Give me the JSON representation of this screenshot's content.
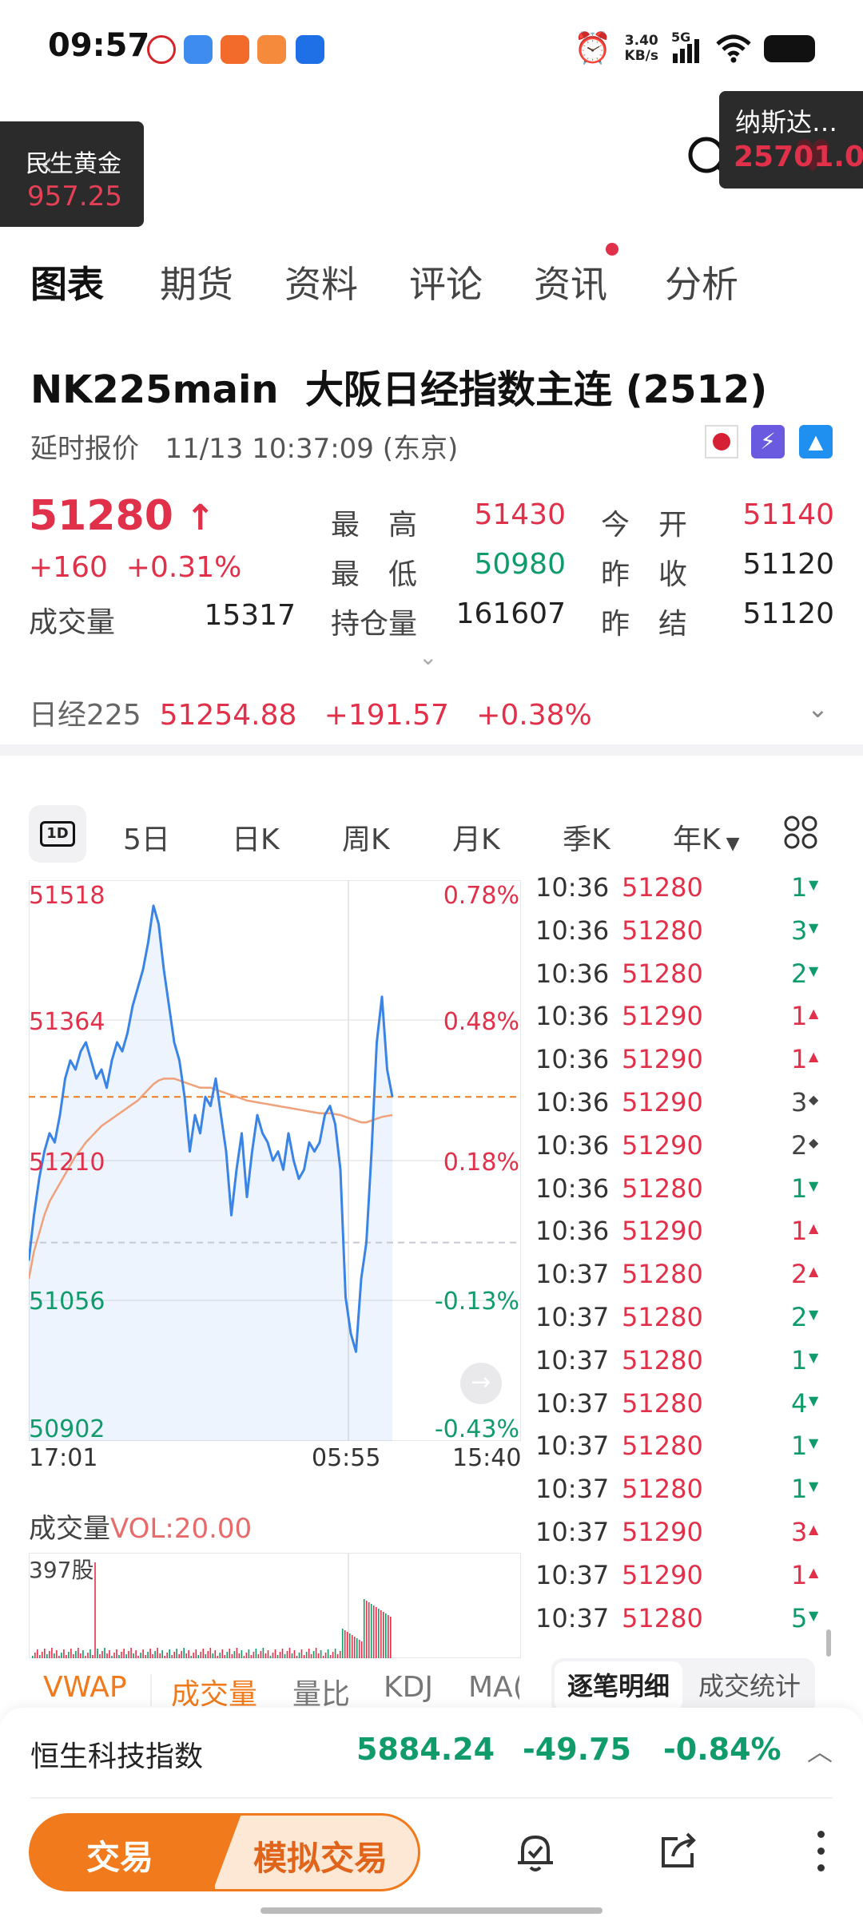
{
  "status": {
    "time": "09:57",
    "speed_top": "3.40",
    "speed_bottom": "KB/s",
    "network": "5G"
  },
  "float_left": {
    "name": "民生黄金",
    "value": "957.25"
  },
  "float_right": {
    "name": "纳斯达…",
    "value": "25701.0"
  },
  "tabs": [
    "图表",
    "期货",
    "资料",
    "评论",
    "资讯",
    "分析"
  ],
  "header": {
    "symbol": "NK225main",
    "name": "大阪日经指数主连 (2512)",
    "delay_label": "延时报价",
    "datetime": "11/13 10:37:09 (东京)"
  },
  "quote": {
    "price": "51280",
    "change": "+160",
    "change_pct": "+0.31%",
    "volume_label": "成交量",
    "volume": "15317",
    "high_label": "最　高",
    "high": "51430",
    "low_label": "最　低",
    "low": "50980",
    "oi_label": "持仓量",
    "oi": "161607",
    "open_label": "今　开",
    "open": "51140",
    "prev_close_label": "昨　收",
    "prev_close": "51120",
    "prev_settle_label": "昨　结",
    "prev_settle": "51120"
  },
  "index_line": {
    "name": "日经225",
    "value": "51254.88",
    "change": "+191.57",
    "pct": "+0.38%"
  },
  "chart_tabs": {
    "d1": "1D",
    "items": [
      "5日",
      "日K",
      "周K",
      "月K",
      "季K",
      "年K"
    ]
  },
  "chart_data": {
    "type": "line",
    "y_price_labels": [
      "51518",
      "51364",
      "51210",
      "51056",
      "50902"
    ],
    "y_pct_labels": [
      "0.78%",
      "0.48%",
      "0.18%",
      "-0.13%",
      "-0.43%"
    ],
    "x_labels": [
      "17:01",
      "05:55",
      "15:40"
    ],
    "ylim": [
      50902,
      51518
    ],
    "prev_close": 51120,
    "last": 51280,
    "series": [
      {
        "values": [
          51100,
          51150,
          51190,
          51220,
          51240,
          51230,
          51260,
          51300,
          51320,
          51310,
          51330,
          51340,
          51320,
          51300,
          51310,
          51290,
          51320,
          51340,
          51330,
          51350,
          51380,
          51400,
          51420,
          51450,
          51490,
          51470,
          51420,
          51380,
          51340,
          51320,
          51280,
          51220,
          51260,
          51240,
          51280,
          51270,
          51300,
          51260,
          51220,
          51150,
          51200,
          51240,
          51170,
          51220,
          51260,
          51240,
          51230,
          51210,
          51220,
          51200,
          51240,
          51210,
          51190,
          51200,
          51230,
          51220,
          51230,
          51260,
          51270,
          51250,
          51200,
          51060,
          51020,
          51000,
          51080,
          51120,
          51220,
          51340,
          51390,
          51310,
          51280
        ]
      },
      {
        "values": [
          51080,
          51110,
          51130,
          51150,
          51165,
          51175,
          51185,
          51195,
          51205,
          51215,
          51222,
          51230,
          51236,
          51242,
          51248,
          51252,
          51256,
          51260,
          51264,
          51268,
          51272,
          51276,
          51282,
          51288,
          51294,
          51298,
          51300,
          51300,
          51300,
          51298,
          51296,
          51294,
          51292,
          51290,
          51290,
          51290,
          51288,
          51286,
          51284,
          51282,
          51280,
          51278,
          51276,
          51275,
          51274,
          51273,
          51272,
          51271,
          51270,
          51269,
          51268,
          51267,
          51266,
          51265,
          51264,
          51263,
          51262,
          51262,
          51262,
          51261,
          51260,
          51258,
          51256,
          51254,
          51252,
          51252,
          51254,
          51256,
          51258,
          51259,
          51260
        ]
      }
    ]
  },
  "volume": {
    "label": "成交量",
    "vol": "VOL:20.00",
    "max": "397股"
  },
  "ticks": [
    {
      "t": "10:36",
      "p": "51280",
      "q": "1",
      "dir": "down"
    },
    {
      "t": "10:36",
      "p": "51280",
      "q": "3",
      "dir": "down"
    },
    {
      "t": "10:36",
      "p": "51280",
      "q": "2",
      "dir": "down"
    },
    {
      "t": "10:36",
      "p": "51290",
      "q": "1",
      "dir": "up"
    },
    {
      "t": "10:36",
      "p": "51290",
      "q": "1",
      "dir": "up"
    },
    {
      "t": "10:36",
      "p": "51290",
      "q": "3",
      "dir": "flat"
    },
    {
      "t": "10:36",
      "p": "51290",
      "q": "2",
      "dir": "flat"
    },
    {
      "t": "10:36",
      "p": "51280",
      "q": "1",
      "dir": "down"
    },
    {
      "t": "10:36",
      "p": "51290",
      "q": "1",
      "dir": "up"
    },
    {
      "t": "10:37",
      "p": "51280",
      "q": "2",
      "dir": "up"
    },
    {
      "t": "10:37",
      "p": "51280",
      "q": "2",
      "dir": "down"
    },
    {
      "t": "10:37",
      "p": "51280",
      "q": "1",
      "dir": "down"
    },
    {
      "t": "10:37",
      "p": "51280",
      "q": "4",
      "dir": "down"
    },
    {
      "t": "10:37",
      "p": "51280",
      "q": "1",
      "dir": "down"
    },
    {
      "t": "10:37",
      "p": "51280",
      "q": "1",
      "dir": "down"
    },
    {
      "t": "10:37",
      "p": "51290",
      "q": "3",
      "dir": "up"
    },
    {
      "t": "10:37",
      "p": "51290",
      "q": "1",
      "dir": "up"
    },
    {
      "t": "10:37",
      "p": "51280",
      "q": "5",
      "dir": "down"
    }
  ],
  "indicator_tabs": [
    "VWAP",
    "成交量",
    "量比",
    "KDJ",
    "MA("
  ],
  "detail_tabs": [
    "逐笔明细",
    "成交统计"
  ],
  "hs_tech": {
    "name": "恒生科技指数",
    "value": "5884.24",
    "change": "-49.75",
    "pct": "-0.84%"
  },
  "actions": {
    "trade": "交易",
    "sim_trade": "模拟交易"
  },
  "colors": {
    "up": "#e0304a",
    "down": "#0f9b6a",
    "accent": "#f07a1c",
    "line": "#3a84e6",
    "avg": "#f0a07a"
  }
}
